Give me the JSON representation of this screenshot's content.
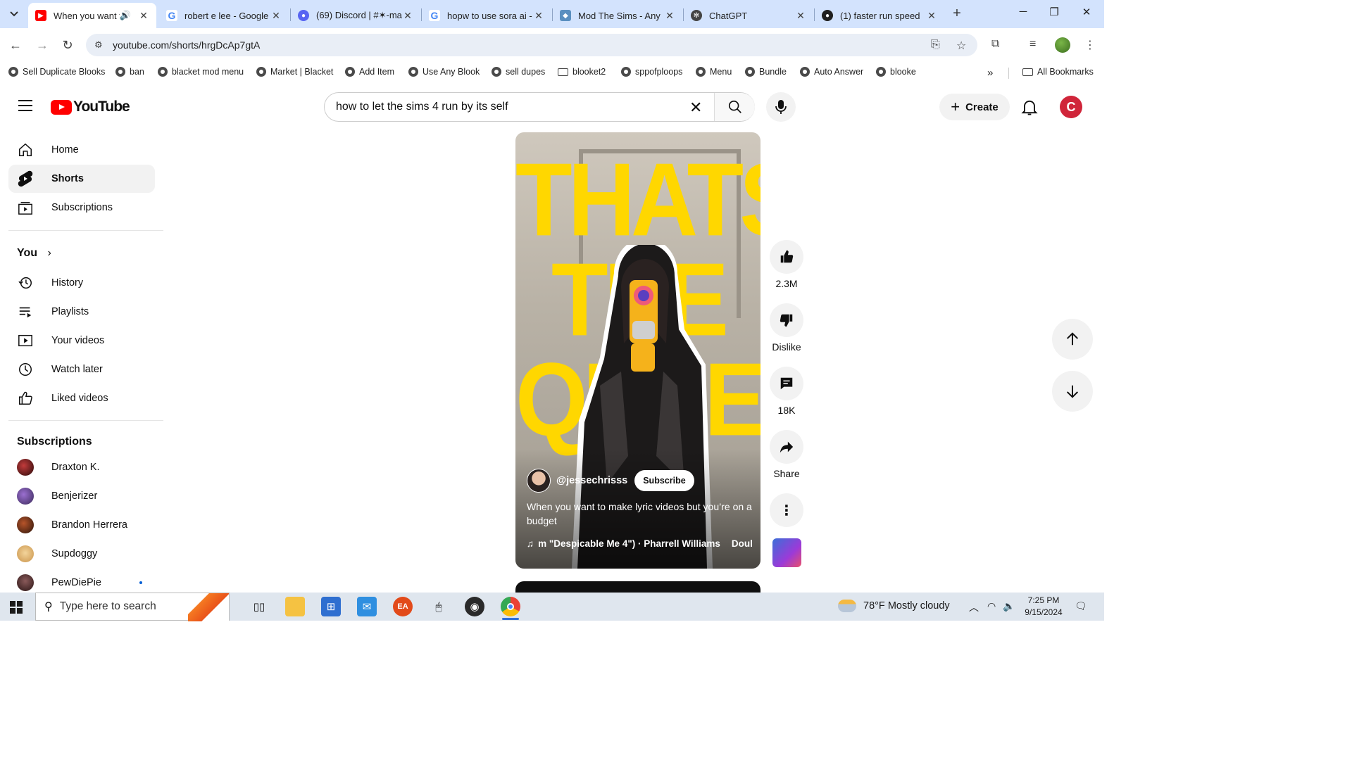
{
  "browser": {
    "tabs": [
      {
        "title": "When you want t",
        "favicon": "youtube-icon",
        "favicon_color": "#ff0000",
        "active": true
      },
      {
        "title": "robert e lee - Google",
        "favicon": "google-icon",
        "favicon_color": "#4285f4"
      },
      {
        "title": "(69) Discord | #✶-ma",
        "favicon": "discord-icon",
        "favicon_color": "#5865f2"
      },
      {
        "title": "hopw to use sora ai -",
        "favicon": "google-icon",
        "favicon_color": "#4285f4"
      },
      {
        "title": "Mod The Sims - Any",
        "favicon": "modthesims-icon",
        "favicon_color": "#5a8fc0"
      },
      {
        "title": "ChatGPT",
        "favicon": "chatgpt-icon",
        "favicon_color": "#444444"
      },
      {
        "title": "(1) faster run speed",
        "favicon": "github-icon",
        "favicon_color": "#1f1f1f"
      }
    ],
    "url": "youtube.com/shorts/hrgDcAp7gtA",
    "bookmarks": [
      {
        "label": "Sell Duplicate Blooks",
        "type": "link"
      },
      {
        "label": "ban",
        "type": "link"
      },
      {
        "label": "blacket mod menu",
        "type": "link"
      },
      {
        "label": "Market | Blacket",
        "type": "link"
      },
      {
        "label": "Add Item",
        "type": "link"
      },
      {
        "label": "Use Any Blook",
        "type": "link"
      },
      {
        "label": "sell dupes",
        "type": "link"
      },
      {
        "label": "blooket2",
        "type": "folder"
      },
      {
        "label": "sppofploops",
        "type": "link"
      },
      {
        "label": "Menu",
        "type": "link"
      },
      {
        "label": "Bundle",
        "type": "link"
      },
      {
        "label": "Auto Answer",
        "type": "link"
      },
      {
        "label": "blooke",
        "type": "link"
      }
    ],
    "all_bookmarks_label": "All Bookmarks"
  },
  "youtube": {
    "logo_text": "YouTube",
    "search_value": "how to let the sims 4 run by its self",
    "create_label": "Create",
    "avatar_letter": "C",
    "accent_color": "#ff0000"
  },
  "sidebar": {
    "main": [
      {
        "label": "Home",
        "icon": "home-icon"
      },
      {
        "label": "Shorts",
        "icon": "shorts-icon",
        "active": true
      },
      {
        "label": "Subscriptions",
        "icon": "subscriptions-icon"
      }
    ],
    "you_heading": "You",
    "you_items": [
      {
        "label": "History",
        "icon": "history-icon"
      },
      {
        "label": "Playlists",
        "icon": "playlists-icon"
      },
      {
        "label": "Your videos",
        "icon": "your-videos-icon"
      },
      {
        "label": "Watch later",
        "icon": "watch-later-icon"
      },
      {
        "label": "Liked videos",
        "icon": "liked-videos-icon"
      }
    ],
    "subscriptions_heading": "Subscriptions",
    "subscriptions": [
      {
        "name": "Draxton K.",
        "color": "#6b1a1a"
      },
      {
        "name": "Benjerizer",
        "color": "#6a3f8f"
      },
      {
        "name": "Brandon Herrera",
        "color": "#4a2a1a"
      },
      {
        "name": "Supdoggy",
        "color": "#e8c27a"
      },
      {
        "name": "PewDiePie",
        "color": "#5a3a3a",
        "live": true
      }
    ]
  },
  "short": {
    "overlay_words": [
      "THATS",
      "THE",
      "QUEEN"
    ],
    "channel": "@jessechrisss",
    "subscribe_label": "Subscribe",
    "title": "When you want to make lyric videos but you’re on a budget",
    "music": "m \"Despicable Me 4\") · Pharrell Williams",
    "music_trail": "Doul",
    "likes": "2.3M",
    "dislike_label": "Dislike",
    "comments": "18K",
    "share_label": "Share"
  },
  "taskbar": {
    "search_placeholder": "Type here to search",
    "weather": "78°F  Mostly cloudy",
    "time": "7:25 PM",
    "date": "9/15/2024"
  }
}
